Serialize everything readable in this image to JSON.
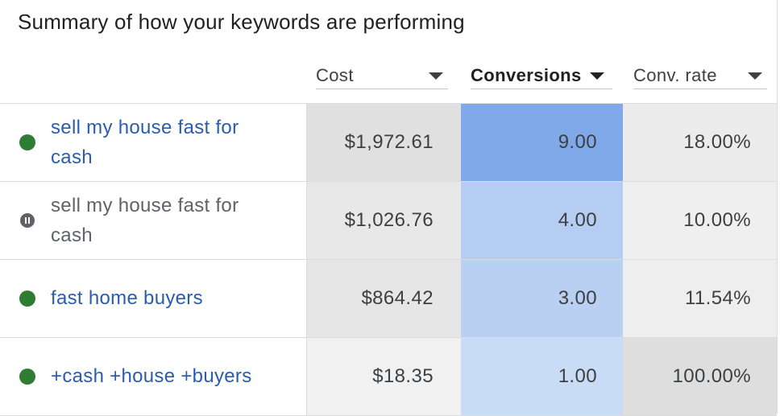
{
  "title": "Summary of how your keywords are performing",
  "columns": {
    "cost": "Cost",
    "conversions": "Conversions",
    "conv_rate": "Conv. rate"
  },
  "sorted_column": "conversions",
  "rows": [
    {
      "status": "enabled",
      "keyword_line1": "sell my house fast for",
      "keyword_line2": "cash",
      "cost": "$1,972.61",
      "conversions": "9.00",
      "conv_rate": "18.00%"
    },
    {
      "status": "paused",
      "keyword_line1": "sell my house fast for",
      "keyword_line2": "cash",
      "cost": "$1,026.76",
      "conversions": "4.00",
      "conv_rate": "10.00%"
    },
    {
      "status": "enabled",
      "keyword_line1": "fast home buyers",
      "keyword_line2": "",
      "cost": "$864.42",
      "conversions": "3.00",
      "conv_rate": "11.54%"
    },
    {
      "status": "enabled",
      "keyword_line1": "+cash +house +buyers",
      "keyword_line2": "",
      "cost": "$18.35",
      "conversions": "1.00",
      "conv_rate": "100.00%"
    }
  ],
  "heatmap_colors": {
    "cost": [
      "#e0e0e0",
      "#e8e8e8",
      "#e6e6e6",
      "#f1f1f1"
    ],
    "conversions": [
      "#80a9ea",
      "#b5cdf2",
      "#b9d0f3",
      "#c9dcf6"
    ],
    "conv_rate": [
      "#ececec",
      "#efefef",
      "#eeeeee",
      "#dedede"
    ]
  },
  "status_colors": {
    "enabled": "#2e7d32",
    "paused": "#5f6368"
  }
}
